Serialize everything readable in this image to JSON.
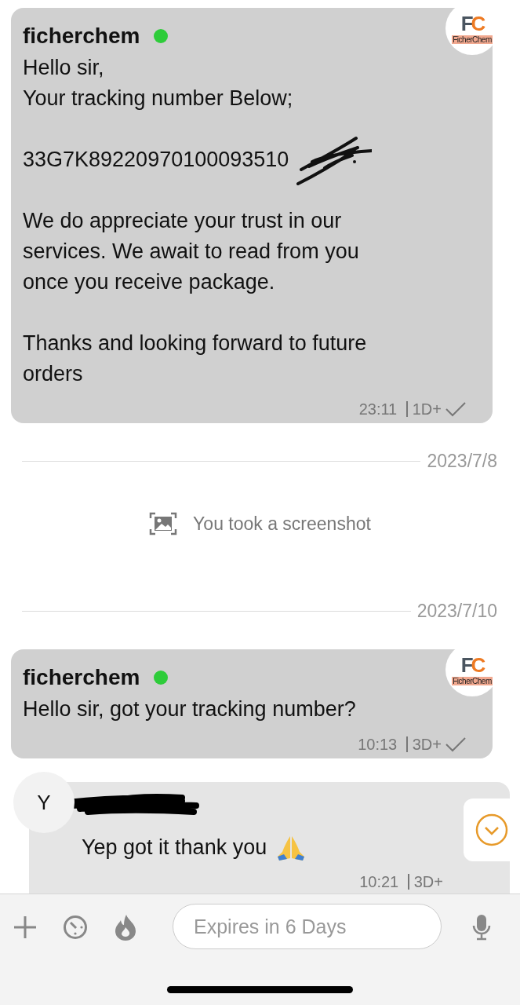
{
  "timeline": [
    {
      "kind": "message",
      "sender": "ficherchem",
      "online": true,
      "avatar": {
        "logo_text": "FC",
        "logo_caption": "FicherChem"
      },
      "paragraphs": [
        {
          "text": "Hello sir,\nYour tracking number Below;",
          "redacted": false,
          "emoji": false
        },
        {
          "text": "33G7K89220970100093510",
          "redacted": true,
          "emoji": false
        },
        {
          "text": "We do appreciate your trust in our services. We await to read from you once you receive package.",
          "redacted": false,
          "emoji": false
        },
        {
          "text": "Thanks and looking forward to future orders",
          "redacted": false,
          "emoji": false
        }
      ],
      "time": "23:11",
      "expiry": "1D+",
      "read": true
    },
    {
      "kind": "date",
      "label": "2023/7/8"
    },
    {
      "kind": "notice",
      "text": "You took a screenshot"
    },
    {
      "kind": "date",
      "label": "2023/7/10"
    },
    {
      "kind": "message",
      "sender": "ficherchem",
      "online": true,
      "avatar": {
        "logo_text": "FC",
        "logo_caption": "FicherChem"
      },
      "paragraphs": [
        {
          "text": "Hello sir, got your tracking number?",
          "redacted": false,
          "emoji": false
        }
      ],
      "time": "10:13",
      "expiry": "3D+",
      "read": true
    },
    {
      "kind": "message",
      "sender_redacted": true,
      "avatar": {
        "letter": "Y"
      },
      "paragraphs": [
        {
          "text": "Yep got it thank you",
          "redacted": false,
          "emoji": true
        }
      ],
      "time": "10:21",
      "expiry": "3D+",
      "read": false
    }
  ],
  "composer": {
    "placeholder": "Expires in 6 Days"
  }
}
